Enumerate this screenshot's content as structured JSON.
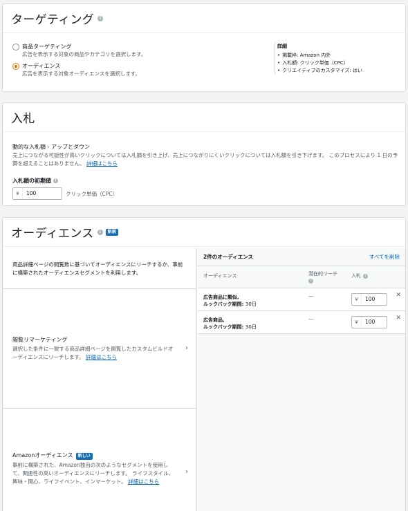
{
  "targeting": {
    "title": "ターゲティング",
    "options": [
      {
        "label": "商品ターゲティング",
        "desc": "広告を表示する対象の商品やカテゴリを選択します。",
        "selected": false
      },
      {
        "label": "オーディエンス",
        "desc": "広告を表示する対象オーディエンスを選択します。",
        "selected": true
      }
    ],
    "details": {
      "title": "詳細",
      "items": [
        "掲載枠: Amazon 内外",
        "入札額: クリック単価（CPC）",
        "クリエイティブのカスタマイズ: はい"
      ]
    }
  },
  "bid": {
    "title": "入札",
    "strategy": "動的な入札額 - アップとダウン",
    "desc": "売上につながる可能性が高いクリックについては入札額を引き上げ、売上につながりにくいクリックについては入札額を引き下げます。 このプロセスにより 1 日の予算を超えることはありません。",
    "desc_link": "詳細はこちら",
    "initial_label": "入札額の初期値",
    "currency": "¥",
    "initial_value": "100",
    "unit": "クリック単価（CPC）"
  },
  "audience": {
    "title": "オーディエンス",
    "badge": "新規",
    "intro": "商品詳細ページの閲覧数に基づいてオーディエンスにリーチするか、事前に構築されたオーディエンスセグメントを利用します。",
    "options": [
      {
        "title": "閲覧リマーケティング",
        "desc": "選択した条件に一致する商品詳細ページを閲覧したカスタムビルドオーディエンスにリーチします。",
        "link": "詳細はこちら"
      },
      {
        "title": "Amazonオーディエンス",
        "badge": "新しい",
        "desc": "事前に構築された、Amazon独自の次のようなセグメントを使用して、関連性の高いオーディエンスにリーチします。 ライフスタイル、興味・関心、ライフイベント、インマーケット。",
        "link": "詳細はこちら"
      }
    ],
    "selected": {
      "count_label": "2件のオーディエンス",
      "clear_all": "すべてを削除",
      "col_audience": "オーディエンス",
      "col_reach": "潜在的リーチ",
      "col_bid": "入札",
      "rows": [
        {
          "name_line1": "広告商品に類似,",
          "name_line2": "ルックバック期間:",
          "lookback": "30日",
          "reach": "—",
          "currency": "¥",
          "bid": "100"
        },
        {
          "name_line1": "広告商品,",
          "name_line2": "ルックバック期間:",
          "lookback": "30日",
          "reach": "—",
          "currency": "¥",
          "bid": "100"
        }
      ]
    }
  },
  "colors": {
    "accent_radio": "#e77600",
    "link": "#0066c0",
    "badge": "#146eb4"
  }
}
